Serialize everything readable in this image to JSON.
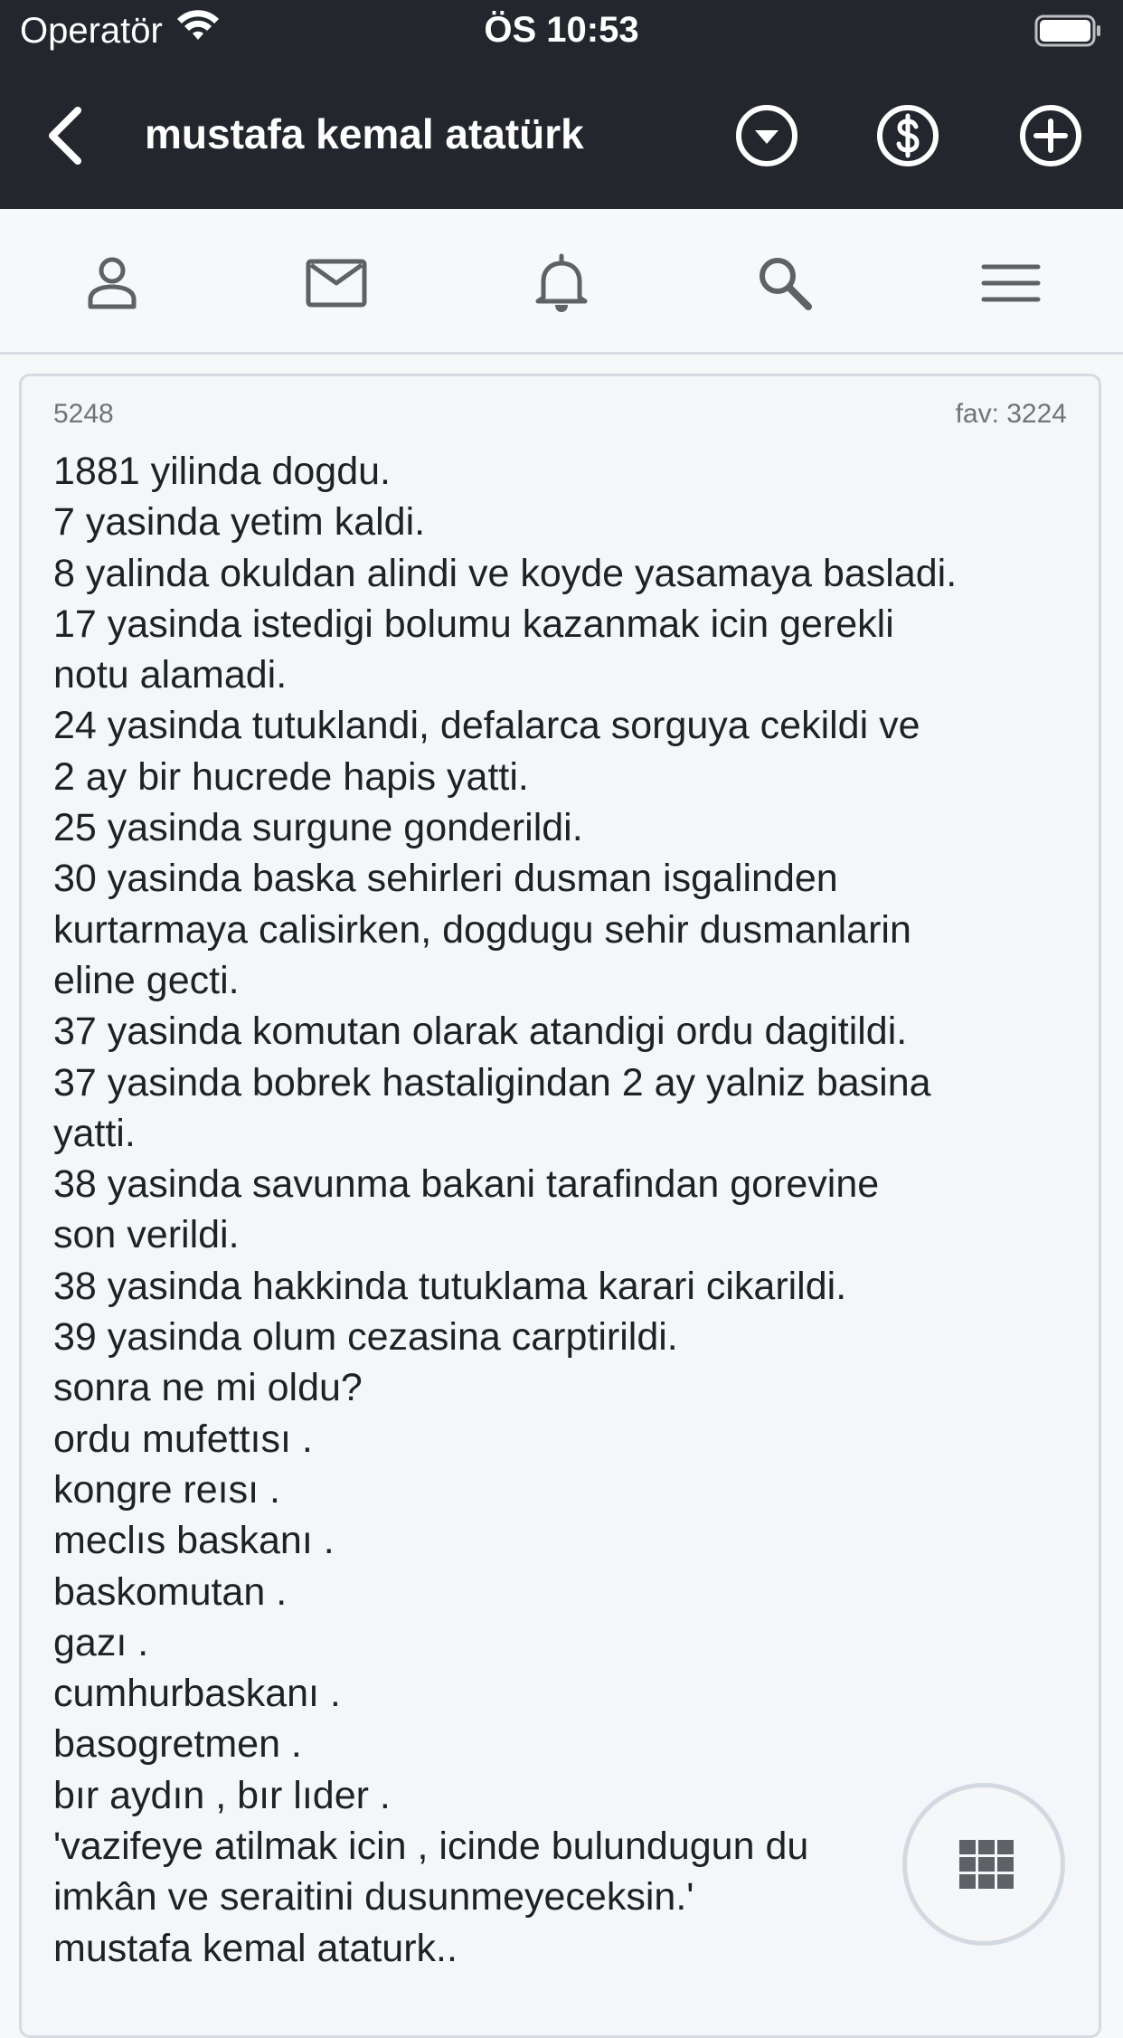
{
  "status_bar": {
    "carrier": "Operatör",
    "time": "ÖS 10:53",
    "icons": [
      "wifi-icon",
      "battery-icon"
    ]
  },
  "nav_bar": {
    "title": "mustafa kemal atatürk",
    "back_icon": "chevron-left-icon",
    "actions": [
      "chevron-down-circle-icon",
      "dollar-circle-icon",
      "plus-circle-icon"
    ]
  },
  "tab_bar": {
    "items": [
      "user-icon",
      "mail-icon",
      "bell-icon",
      "search-icon",
      "menu-icon"
    ]
  },
  "entry": {
    "id": "5248",
    "fav": "fav: 3224",
    "lines": [
      "1881 yilinda dogdu.",
      "7 yasinda yetim kaldi.",
      "8 yalinda okuldan alindi ve koyde yasamaya basladi.",
      "17 yasinda istedigi bolumu kazanmak icin gerekli",
      "notu alamadi.",
      "24 yasinda tutuklandi, defalarca sorguya cekildi ve",
      "2 ay bir hucrede hapis yatti.",
      "25 yasinda surgune gonderildi.",
      "30 yasinda baska sehirleri dusman isgalinden",
      "kurtarmaya calisirken, dogdugu sehir dusmanlarin",
      "eline gecti.",
      "37 yasinda komutan olarak atandigi ordu dagitildi.",
      "37 yasinda bobrek hastaligindan 2 ay yalniz basina",
      "yatti.",
      "38 yasinda savunma bakani tarafindan gorevine",
      "son verildi.",
      "38 yasinda hakkinda tutuklama karari cikarildi.",
      "39 yasinda olum cezasina carptirildi.",
      "sonra ne mi oldu?",
      "ordu mufettısı .",
      "kongre reısı .",
      "meclıs baskanı .",
      "baskomutan .",
      "gazı .",
      "cumhurbaskanı .",
      "basogretmen .",
      "bır aydın , bır lıder .",
      "'vazifeye atilmak icin , icinde bulundugun du",
      "imkân ve seraitini dusunmeyeceksin.'",
      "mustafa kemal ataturk.."
    ]
  },
  "fab": {
    "icon": "grid-icon"
  },
  "colors": {
    "header_bg": "#23272d",
    "page_bg": "#f7f8fa",
    "card_bg": "#f4f6f9",
    "card_border": "#d6dbe2",
    "icon_gray": "#5e6267",
    "text": "#1e2125",
    "meta_text": "#707478"
  }
}
